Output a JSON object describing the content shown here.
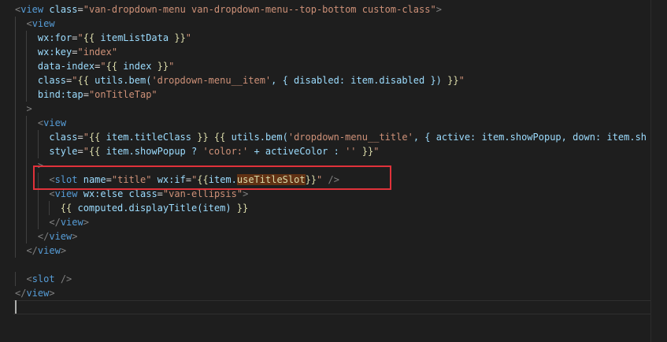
{
  "editor": {
    "language": "wxml",
    "theme": "dark",
    "cursor_line": 22,
    "highlighted_line": 12,
    "lines": [
      "<view class=\"van-dropdown-menu van-dropdown-menu--top-bottom custom-class\">",
      "  <view",
      "    wx:for=\"{{ itemListData }}\"",
      "    wx:key=\"index\"",
      "    data-index=\"{{ index }}\"",
      "    class=\"{{ utils.bem('dropdown-menu__item', { disabled: item.disabled }) }}\"",
      "    bind:tap=\"onTitleTap\"",
      "  >",
      "    <view",
      "      class=\"{{ item.titleClass }} {{ utils.bem('dropdown-menu__title', { active: item.showPopup, down: item.sh",
      "      style=\"{{ item.showPopup ? 'color:' + activeColor : '' }}\"",
      "    >",
      "      <slot name=\"title\" wx:if=\"{{item.useTitleSlot}}\" />",
      "      <view wx:else class=\"van-ellipsis\">",
      "        {{ computed.displayTitle(item) }}",
      "      </view>",
      "    </view>",
      "  </view>",
      "",
      "  <slot />",
      "</view>",
      ""
    ]
  },
  "colors": {
    "background": "#1e1e1e",
    "tag": "#569cd6",
    "attribute": "#9cdcfe",
    "string": "#ce9178",
    "template_brace": "#dcdcaa",
    "annotation_box": "#e0323a"
  }
}
